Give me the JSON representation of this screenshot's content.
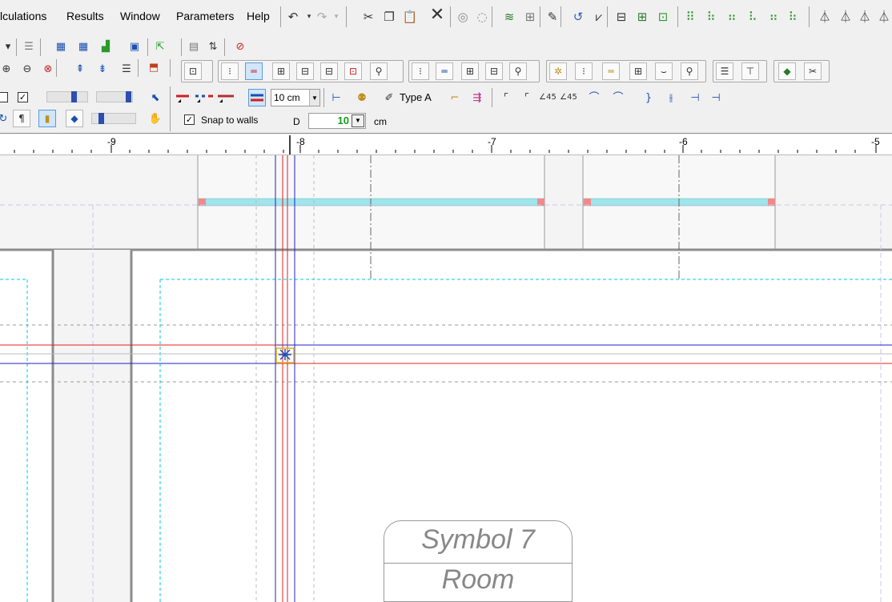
{
  "menu": {
    "items": [
      "lculations",
      "Results",
      "Window",
      "Parameters",
      "Help"
    ]
  },
  "toolbar": {
    "line_width_value": "10 cm",
    "type_label": "Type A",
    "snap_to_walls_label": "Snap to walls",
    "snap_to_walls_checked": true,
    "top_checkbox_checked": true,
    "distance_label": "D",
    "distance_value": "10",
    "distance_unit": "cm"
  },
  "ruler": {
    "labels": [
      "-9",
      "-8",
      "-7",
      "-6",
      "-5"
    ]
  },
  "canvas": {
    "room_symbol": {
      "line1": "Symbol 7",
      "line2": "Room"
    }
  },
  "colors": {
    "window_fill": "#9ee5ec",
    "window_end": "#f08a8a",
    "guide_red": "#e02020",
    "guide_blue": "#2020c0",
    "guide_cyan": "#00c8e0",
    "wall_gray": "#8c8c8c",
    "wall_fill": "#f4f4f4"
  },
  "icons": [
    "undo-icon",
    "redo-icon",
    "cut-icon",
    "copy-icon",
    "paste-icon",
    "delete-icon",
    "zoom-in-icon",
    "zoom-out-icon",
    "zoom-window-icon",
    "sort-icon",
    "no-entry-icon",
    "pen-icon",
    "snap-cursor-icon"
  ]
}
